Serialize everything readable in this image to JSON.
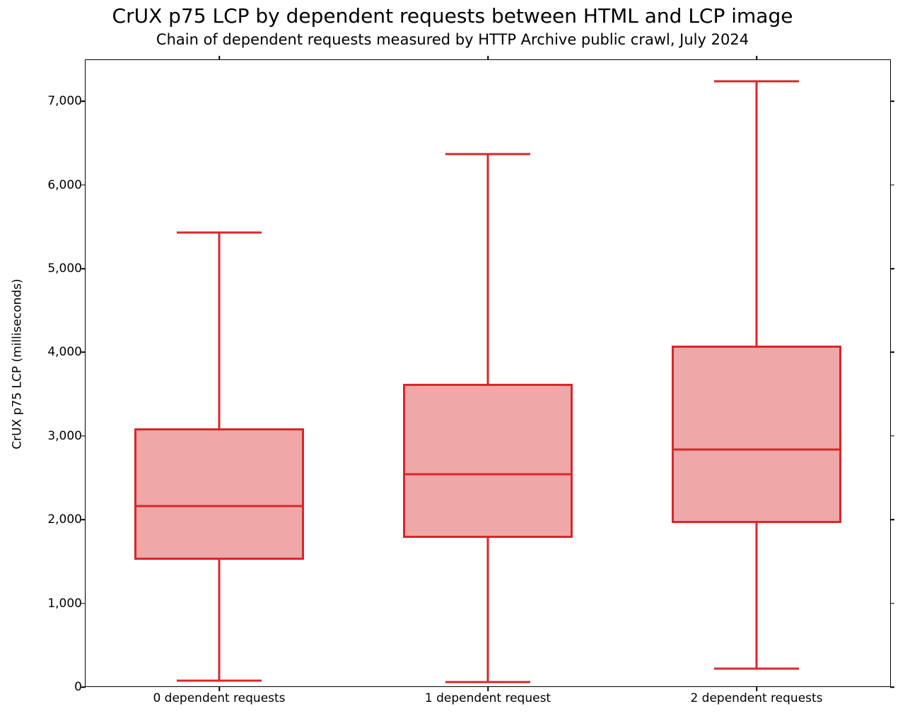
{
  "chart_data": {
    "type": "box",
    "title": "CrUX p75 LCP by dependent requests between HTML and LCP image",
    "subtitle": "Chain of dependent requests measured by HTTP Archive public crawl, July 2024",
    "ylabel": "CrUX p75 LCP (milliseconds)",
    "xlabel": "",
    "categories": [
      "0 dependent requests",
      "1 dependent request",
      "2 dependent requests"
    ],
    "ylim": [
      0,
      7500
    ],
    "yticks": [
      0,
      1000,
      2000,
      3000,
      4000,
      5000,
      6000,
      7000
    ],
    "ytick_labels": [
      "0",
      "1,000",
      "2,000",
      "3,000",
      "4,000",
      "5,000",
      "6,000",
      "7,000"
    ],
    "series": [
      {
        "name": "0 dependent requests",
        "whisker_low": 80,
        "q1": 1520,
        "median": 2160,
        "q3": 3090,
        "whisker_high": 5430
      },
      {
        "name": "1 dependent request",
        "whisker_low": 60,
        "q1": 1780,
        "median": 2540,
        "q3": 3620,
        "whisker_high": 6370
      },
      {
        "name": "2 dependent requests",
        "whisker_low": 220,
        "q1": 1960,
        "median": 2840,
        "q3": 4080,
        "whisker_high": 7240
      }
    ],
    "colors": {
      "box_fill": "#f0a7a7",
      "box_edge": "#d6282b"
    }
  }
}
